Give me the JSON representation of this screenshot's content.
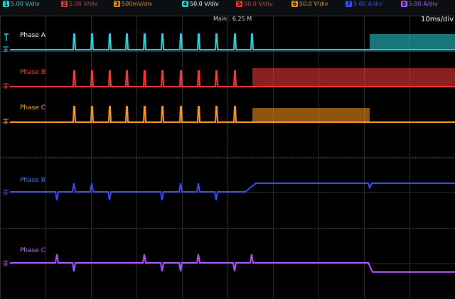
{
  "toolbar": {
    "channels": [
      {
        "num": "1",
        "scale": "5.00 V/div",
        "color": "#2ad6e0",
        "pos": 0
      },
      {
        "num": "2",
        "scale": "5.00 V/div",
        "color": "#d04040",
        "pos": 82
      },
      {
        "num": "3",
        "scale": "500mV/div",
        "color": "#e09020",
        "pos": 156
      },
      {
        "num": "4",
        "scale": "50.0 V/div",
        "color": "#2ad6e0",
        "pos": 252
      },
      {
        "num": "5",
        "scale": "50.0 V/div",
        "color": "#e04040",
        "pos": 328
      },
      {
        "num": "6",
        "scale": "50.0 V/div",
        "color": "#f09a20",
        "pos": 406
      },
      {
        "num": "7",
        "scale": "5.00 A/div",
        "color": "#3050ff",
        "pos": 482
      },
      {
        "num": "8",
        "scale": "5.00 A/div",
        "color": "#b060ff",
        "pos": 560
      }
    ],
    "main_readout": "Main : 6.25 M",
    "timebase": "10ms/div"
  },
  "traces": [
    {
      "label": "Phase A",
      "color": "#2ad6e0"
    },
    {
      "label": "Phase B",
      "color": "#ff3838"
    },
    {
      "label": "Phase C",
      "color": "#ff9a20"
    },
    {
      "label": "Phase B",
      "color": "#3a4cff"
    },
    {
      "label": "Phase C",
      "color": "#b455ff"
    }
  ],
  "colors": {
    "grid": "#2e2e2e",
    "background": "#000000"
  }
}
